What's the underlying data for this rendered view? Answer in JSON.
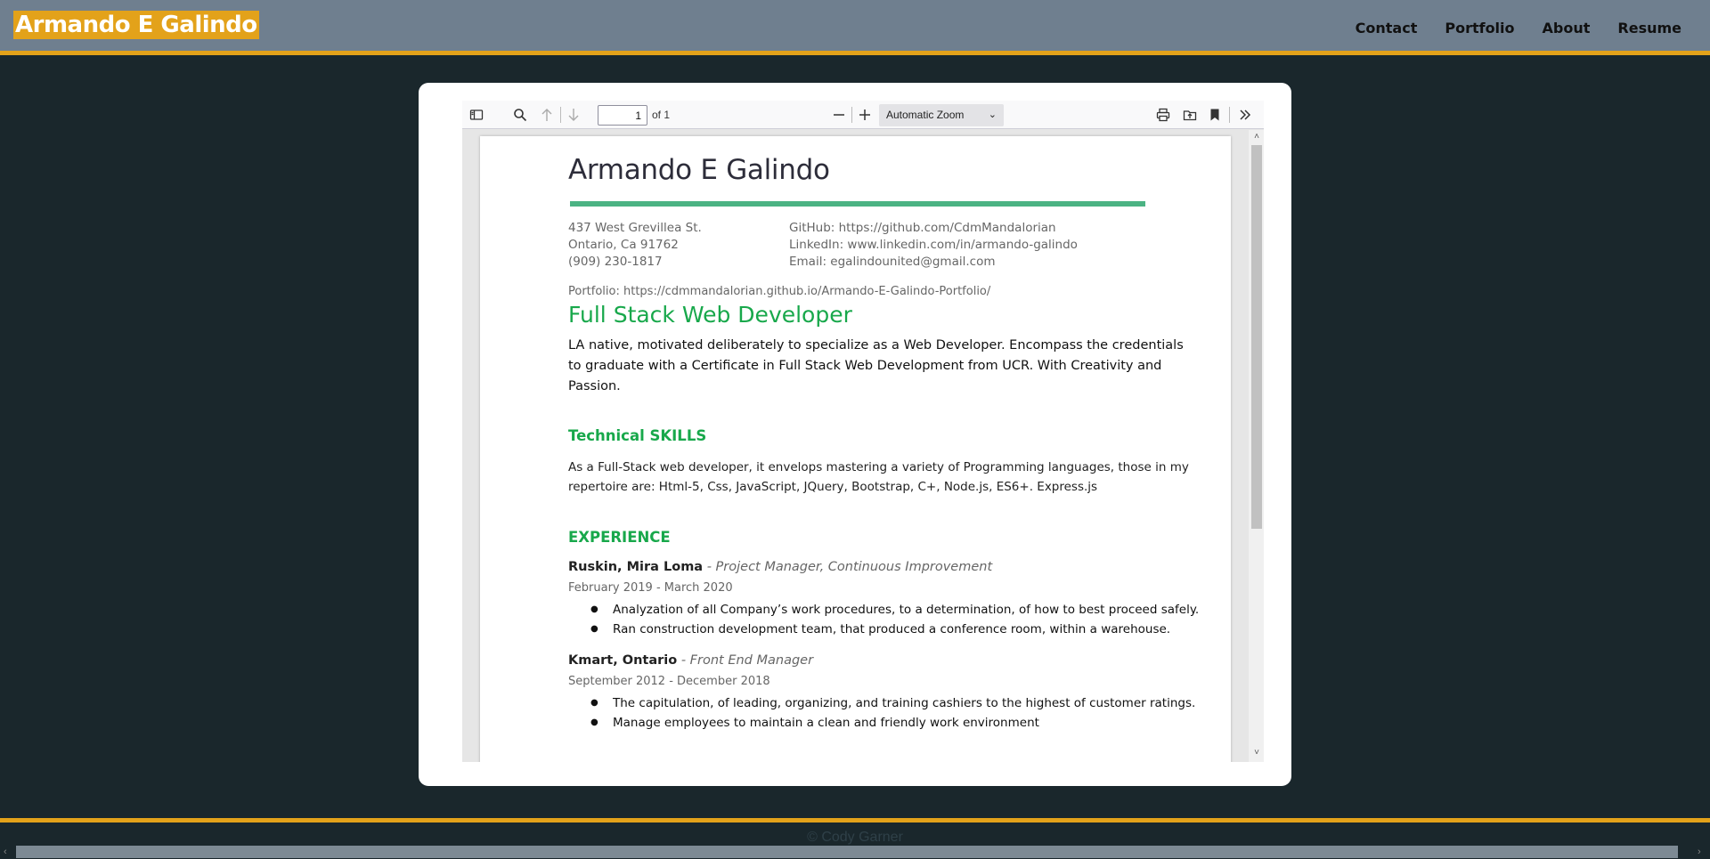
{
  "header": {
    "brand": "Armando E Galindo",
    "nav": [
      "Contact",
      "Portfolio",
      "About",
      "Resume"
    ]
  },
  "viewer": {
    "toolbar": {
      "page_value": "1",
      "page_of": "of 1",
      "zoom": "Automatic Zoom"
    },
    "icons": [
      "sidebar-toggle-icon",
      "search-icon",
      "arrow-up-icon",
      "arrow-down-icon",
      "minus-icon",
      "plus-icon",
      "print-icon",
      "open-file-icon",
      "bookmark-icon",
      "chevrons-right-icon"
    ]
  },
  "resume": {
    "name": "Armando E Galindo",
    "address": [
      "437 West Grevillea St.",
      "Ontario, Ca 91762",
      "(909) 230-1817"
    ],
    "links": [
      "GitHub: https://github.com/CdmMandalorian",
      "LinkedIn: www.linkedin.com/in/armando-galindo",
      "Email: egalindounited@gmail.com"
    ],
    "portfolio": "Portfolio: https://cdmmandalorian.github.io/Armando-E-Galindo-Portfolio/",
    "title": "Full Stack Web Developer",
    "summary": "LA native, motivated deliberately to specialize as a Web Developer. Encompass the credentials to graduate with a Certificate in Full Stack Web Development from UCR. With Creativity and Passion.",
    "skills_heading": "Technical SKILLS",
    "skills_text": "As a Full-Stack web developer, it envelops mastering a variety of Programming languages, those in my repertoire are: Html-5, Css, JavaScript, JQuery, Bootstrap, C+, Node.js, ES6+. Express.js",
    "experience_heading": "EXPERIENCE",
    "jobs": [
      {
        "company": "Ruskin,  Mira Loma",
        "role": " - Project Manager, Continuous Improvement",
        "dates": "February 2019 - March 2020",
        "bullets": [
          "Analyzation of all Company’s work procedures, to a determination, of how to best proceed safely.",
          "Ran construction development team, that produced a conference room,  within a warehouse."
        ]
      },
      {
        "company": "Kmart, Ontario",
        "role": " - Front End Manager",
        "dates": "September 2012 - December 2018",
        "bullets": [
          "The capitulation, of leading, organizing, and training cashiers to the highest of customer ratings.",
          "Manage employees to maintain a clean and friendly work environment"
        ]
      }
    ]
  },
  "footer": {
    "text": "© Cody Garner"
  },
  "colors": {
    "header_bg": "#6f7f8f",
    "accent": "#e3a21a",
    "page_bg": "#1a272c",
    "resume_green": "#18a84b",
    "resume_bar": "#4bb383"
  }
}
